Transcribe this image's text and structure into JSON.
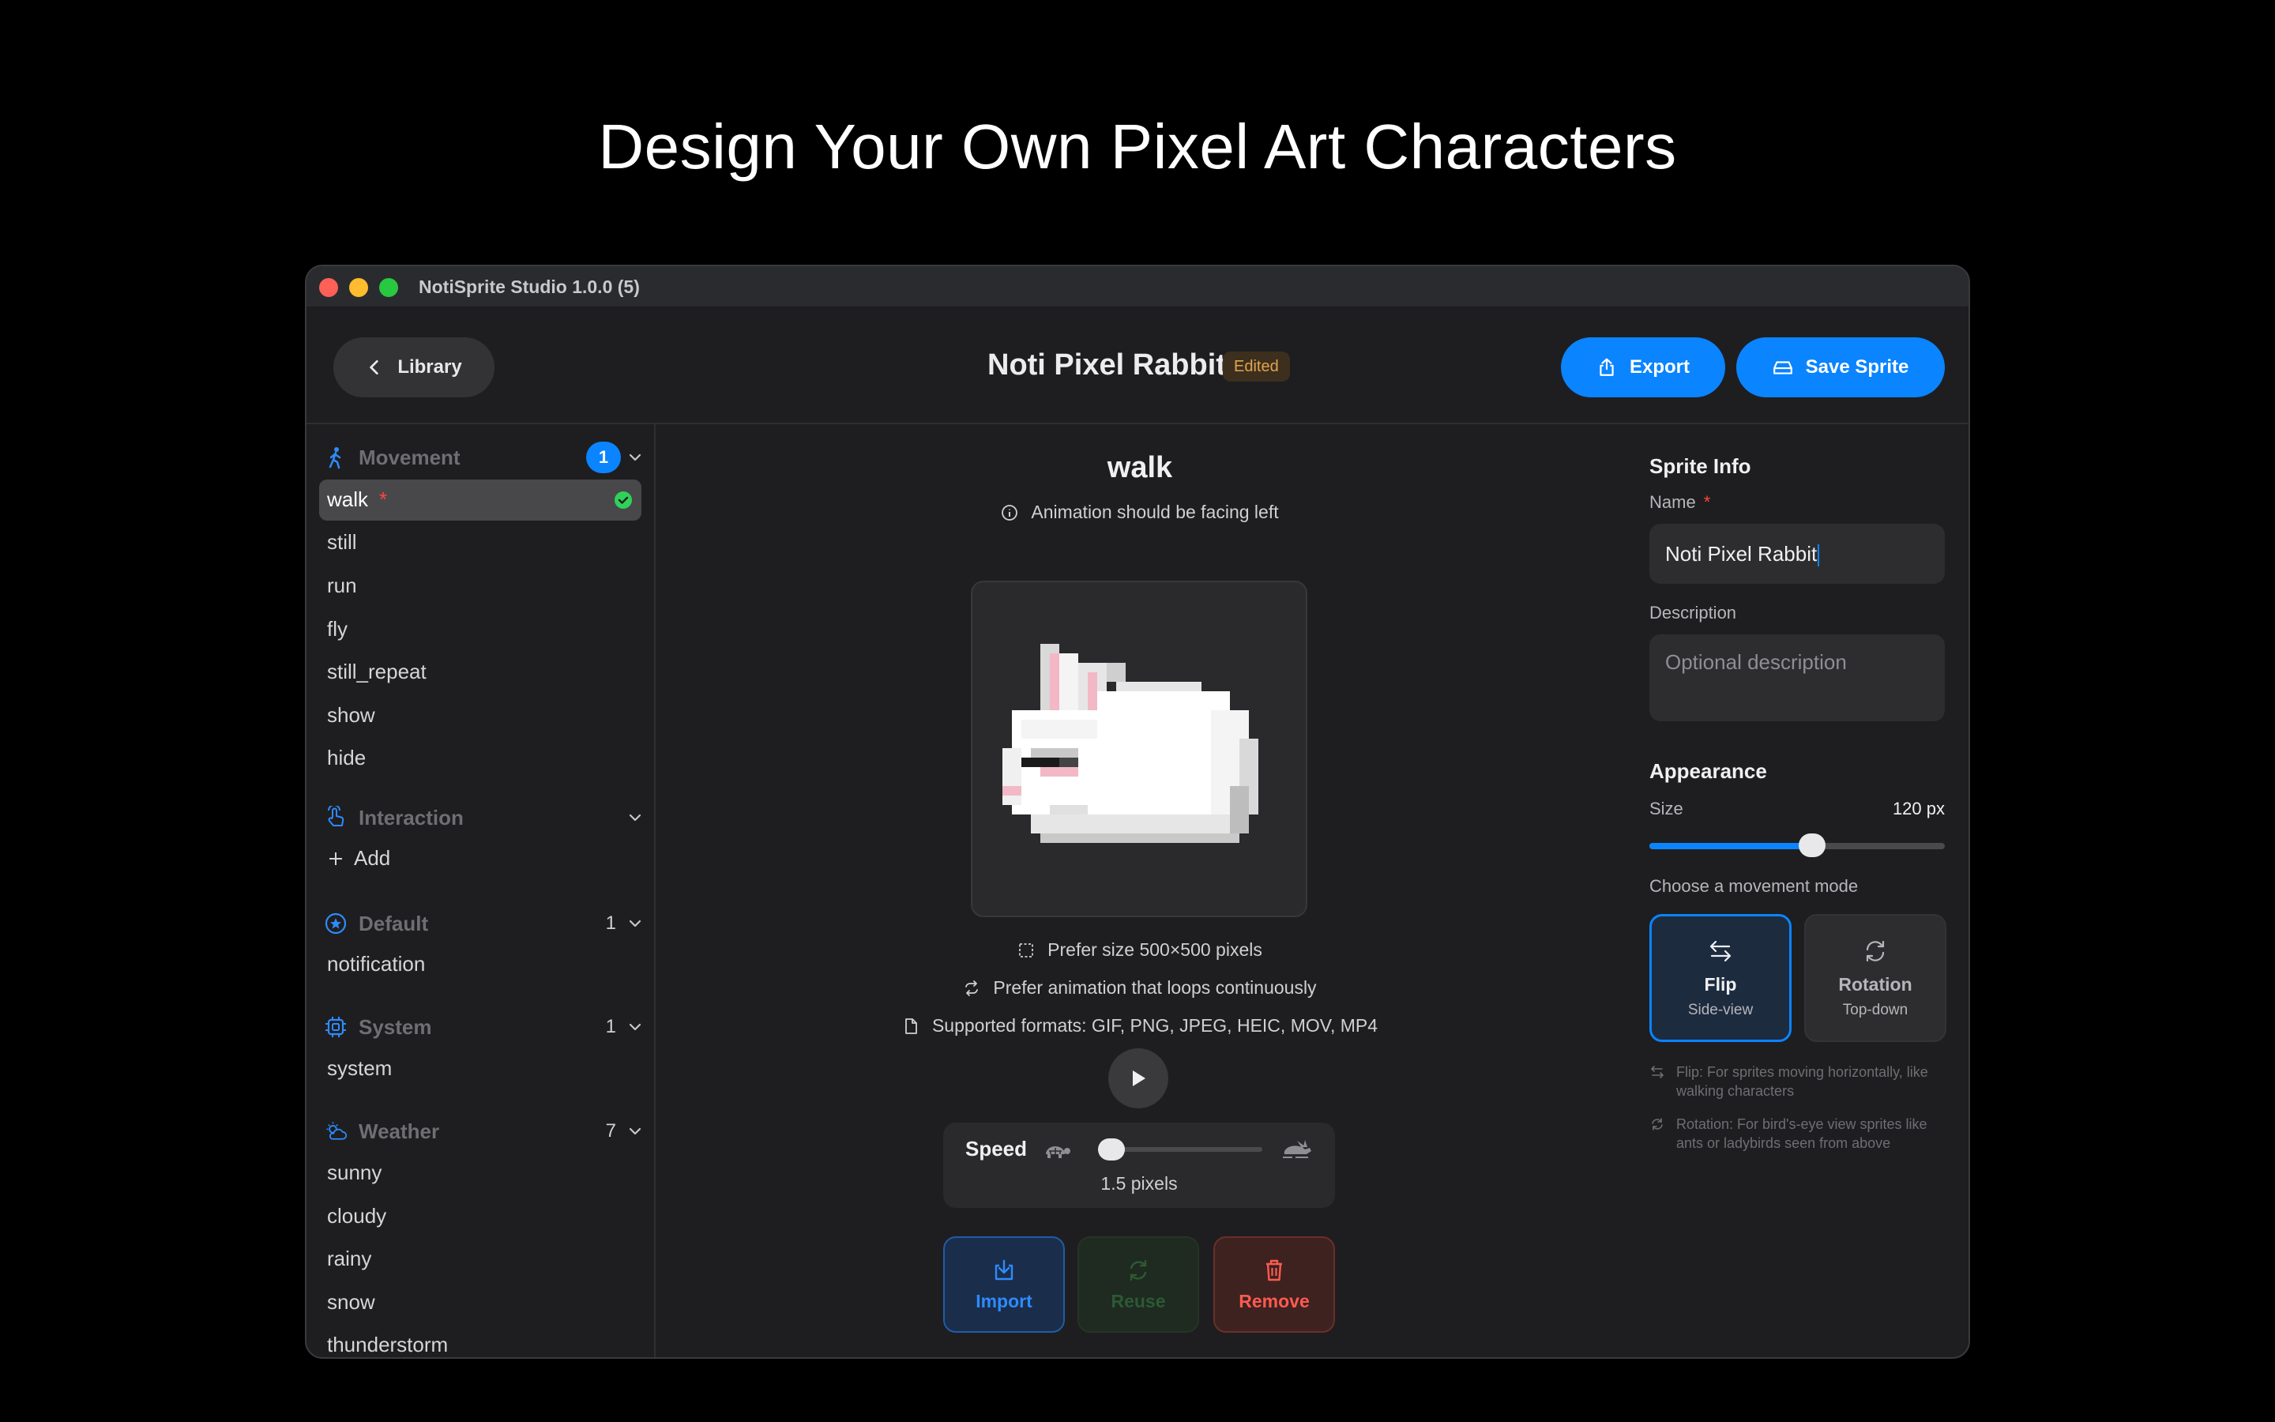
{
  "headline": "Design Your Own Pixel Art Characters",
  "window": {
    "title": "NotiSprite Studio 1.0.0 (5)"
  },
  "toolbar": {
    "library_label": "Library",
    "doc_title": "Noti Pixel Rabbit",
    "edited_badge": "Edited",
    "export_label": "Export",
    "save_label": "Save Sprite"
  },
  "sidebar": {
    "movement": {
      "label": "Movement",
      "badge": "1",
      "items": [
        "walk",
        "still",
        "run",
        "fly",
        "still_repeat",
        "show",
        "hide"
      ],
      "selected_required_mark": "*"
    },
    "interaction": {
      "label": "Interaction",
      "add_label": "Add"
    },
    "default": {
      "label": "Default",
      "count": "1",
      "items": [
        "notification"
      ]
    },
    "system": {
      "label": "System",
      "count": "1",
      "items": [
        "system"
      ]
    },
    "weather": {
      "label": "Weather",
      "count": "7",
      "items": [
        "sunny",
        "cloudy",
        "rainy",
        "snow",
        "thunderstorm"
      ]
    }
  },
  "center": {
    "animation_name": "walk",
    "facing_hint": "Animation should be facing left",
    "size_hint": "Prefer size 500×500 pixels",
    "loop_hint": "Prefer animation that loops continuously",
    "formats_hint": "Supported formats: GIF, PNG, JPEG, HEIC, MOV, MP4",
    "speed": {
      "label": "Speed",
      "value_text": "1.5 pixels",
      "fraction": 0.0
    },
    "actions": {
      "import_label": "Import",
      "reuse_label": "Reuse",
      "remove_label": "Remove"
    }
  },
  "right": {
    "sprite_info_heading": "Sprite Info",
    "name_label": "Name",
    "required_mark": "*",
    "name_value": "Noti Pixel Rabbit",
    "description_label": "Description",
    "description_placeholder": "Optional description",
    "appearance_heading": "Appearance",
    "size_label": "Size",
    "size_value": "120 px",
    "size_fraction": 0.55,
    "movement_mode_label": "Choose a movement mode",
    "modes": {
      "flip": {
        "title": "Flip",
        "subtitle": "Side-view",
        "selected": true
      },
      "rotation": {
        "title": "Rotation",
        "subtitle": "Top-down",
        "selected": false
      }
    },
    "notes": {
      "flip": "Flip: For sprites moving horizontally, like walking characters",
      "rotation": "Rotation: For bird's-eye view sprites like ants or ladybirds seen from above"
    }
  },
  "colors": {
    "accent": "#0a84ff",
    "danger": "#ff453a",
    "success": "#30d158",
    "edited": "#e0a450"
  }
}
